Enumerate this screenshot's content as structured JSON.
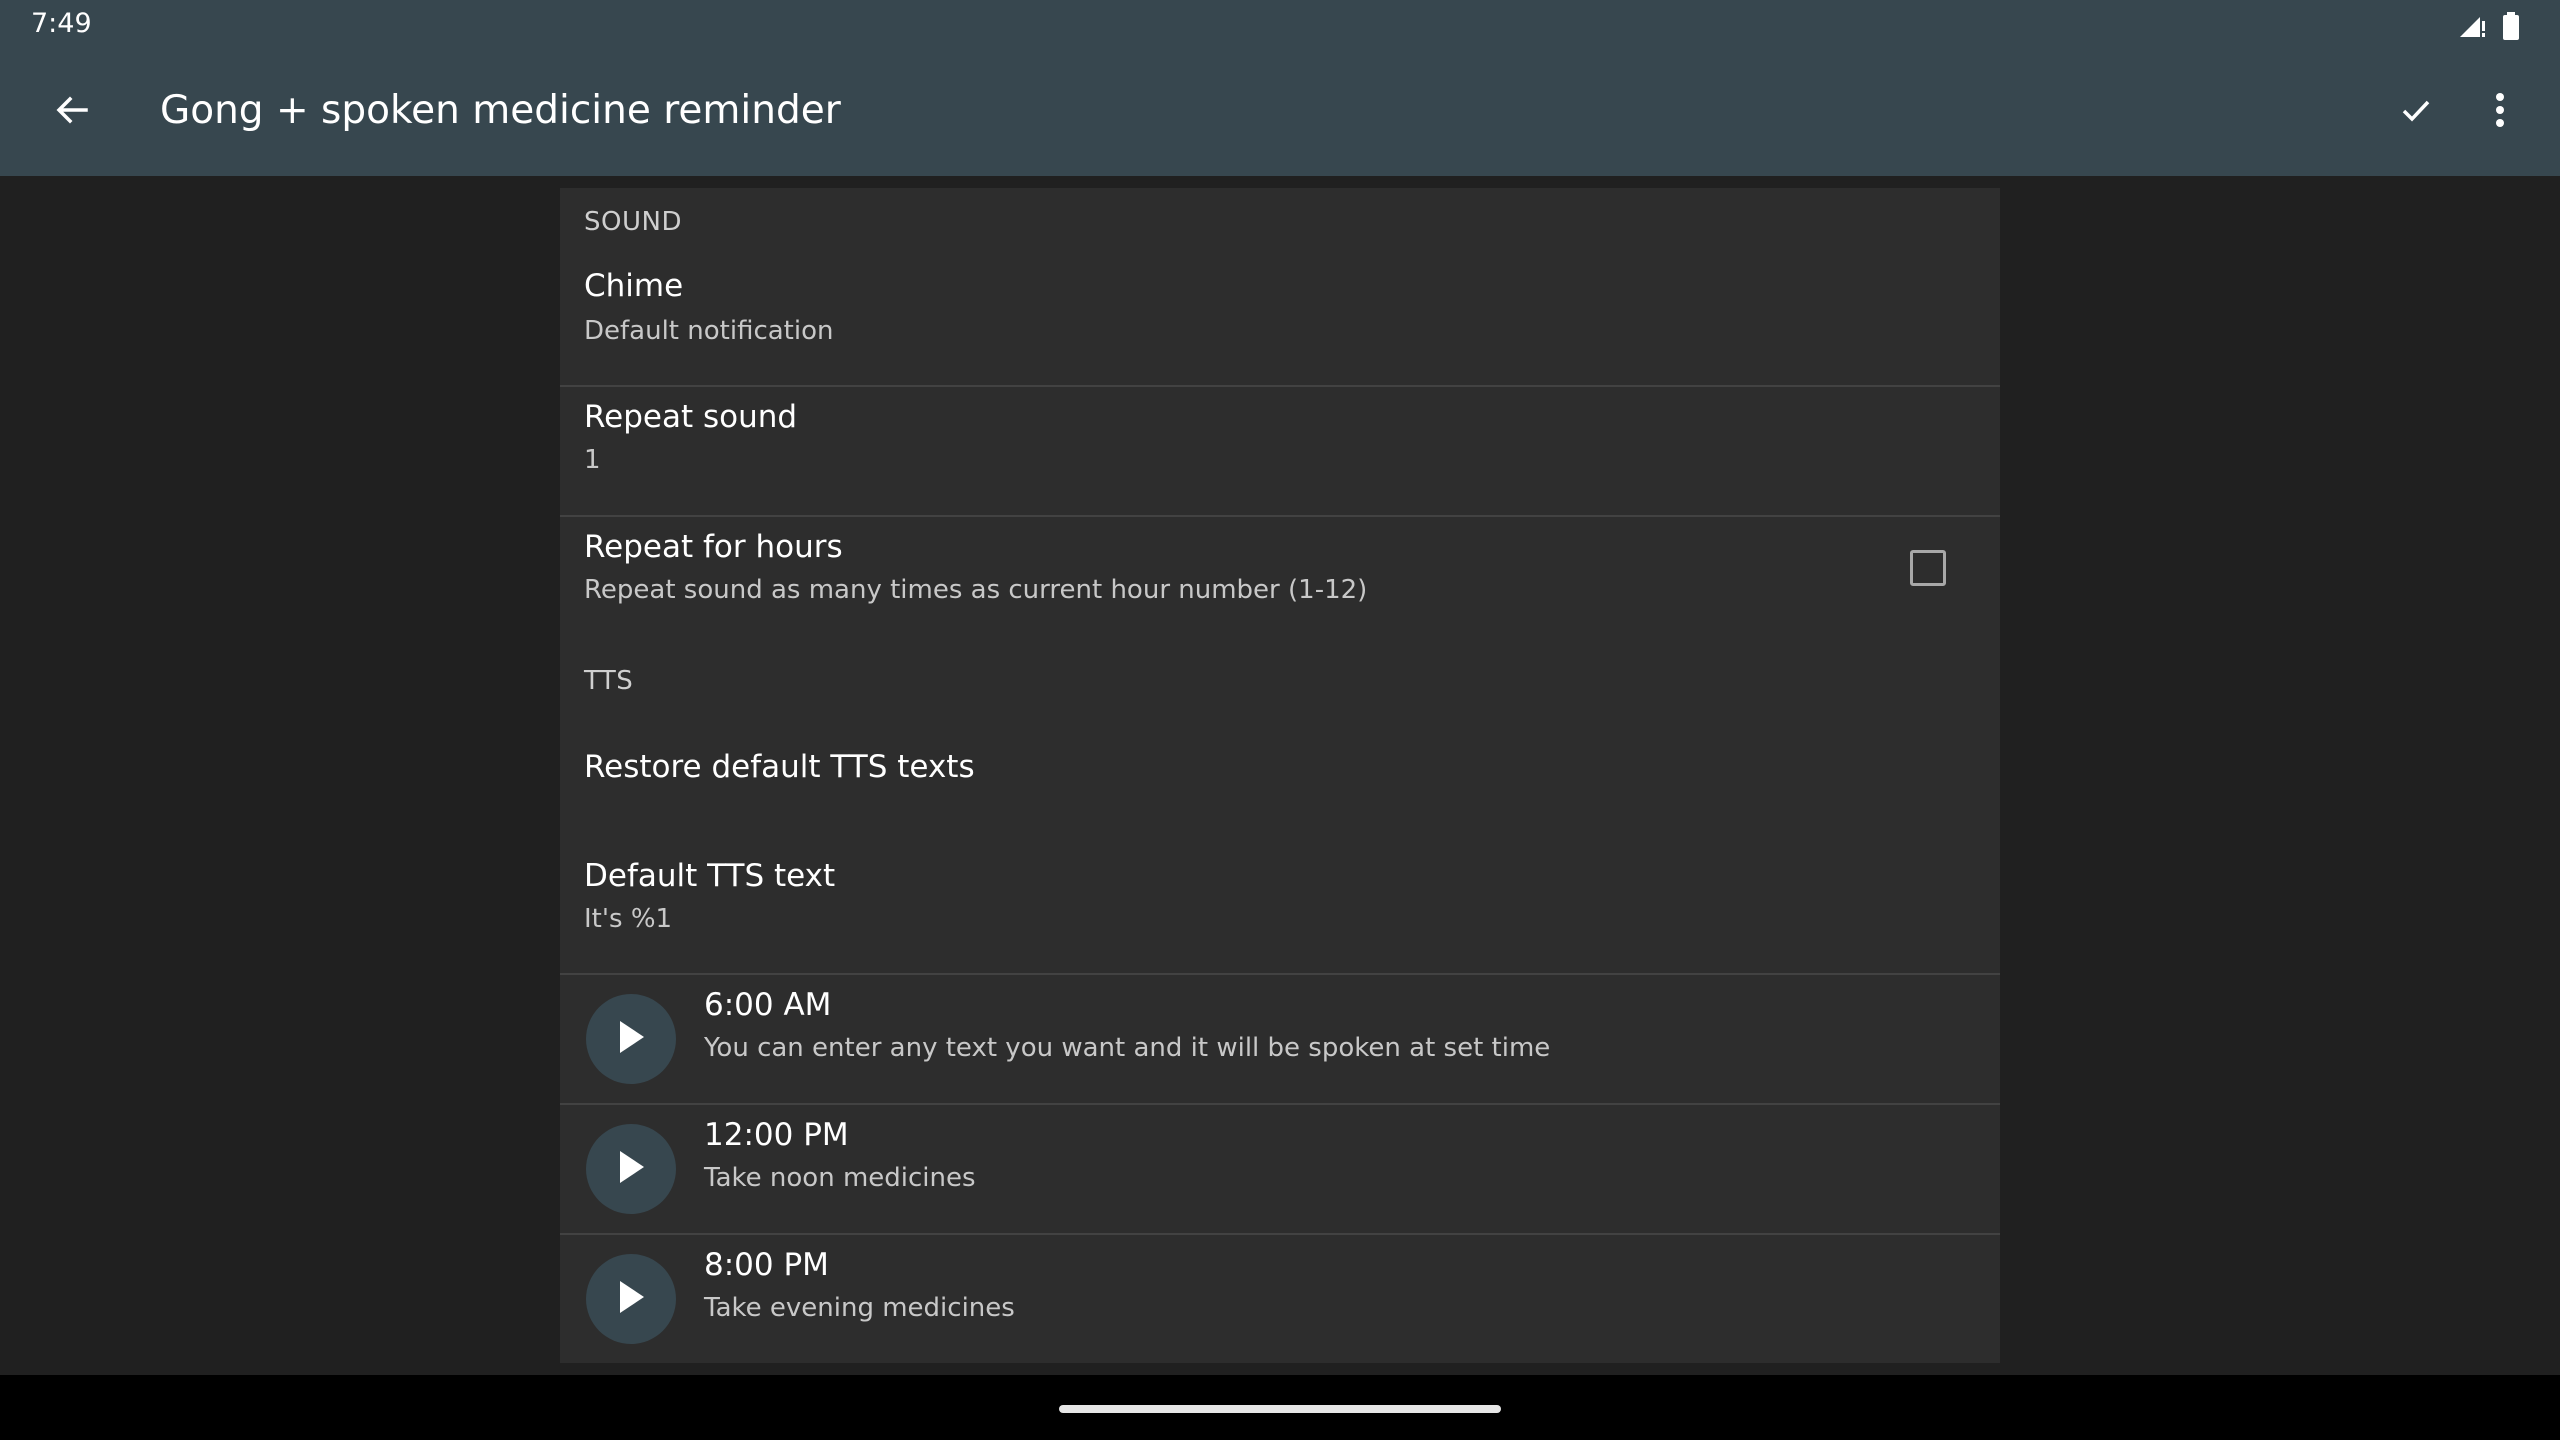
{
  "status_bar": {
    "time": "7:49",
    "icons": [
      "signal-icon",
      "battery-icon"
    ]
  },
  "toolbar": {
    "title": "Gong + spoken medicine reminder",
    "back_icon": "arrow-back-icon",
    "confirm_icon": "check-icon",
    "more_icon": "more-vert-icon"
  },
  "sections": {
    "sound_header": "SOUND",
    "tts_header": "TTS"
  },
  "prefs": {
    "chime": {
      "title": "Chime",
      "summary": "Default notification"
    },
    "repeat_sound": {
      "title": "Repeat sound",
      "summary": "1"
    },
    "repeat_hours": {
      "title": "Repeat for hours",
      "summary": "Repeat sound as many times as current hour number (1-12)",
      "checked": false
    },
    "restore_tts": {
      "title": "Restore default TTS texts"
    },
    "default_tts": {
      "title": "Default TTS text",
      "summary": "It's %1"
    }
  },
  "tts_items": [
    {
      "time": "6:00 AM",
      "text": "You can enter any text you want and it will be spoken at set time"
    },
    {
      "time": "12:00 PM",
      "text": "Take noon medicines"
    },
    {
      "time": "8:00 PM",
      "text": "Take evening medicines"
    }
  ],
  "colors": {
    "toolbar": "#37474f",
    "background": "#202020",
    "card": "#2d2d2d",
    "play_button": "#37474f"
  }
}
